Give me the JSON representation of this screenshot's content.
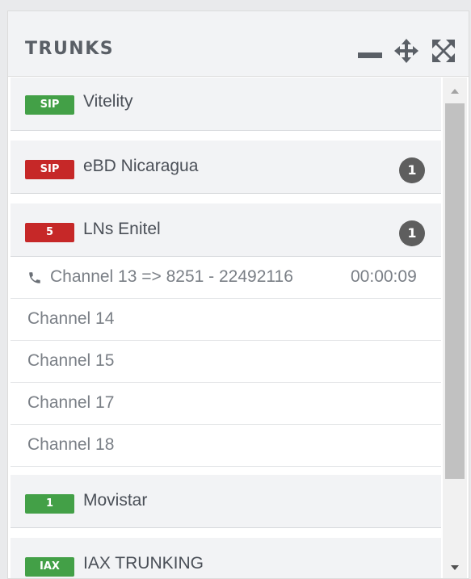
{
  "panel": {
    "title": "TRUNKS",
    "header_icons": [
      "minimize-icon",
      "move-icon",
      "expand-icon"
    ]
  },
  "trunks": [
    {
      "badge": "SIP",
      "badge_color": "#43a047",
      "name": "Vitelity",
      "count": ""
    },
    {
      "badge": "SIP",
      "badge_color": "#c62828",
      "name": "eBD Nicaragua",
      "count": "1"
    },
    {
      "badge": "5",
      "badge_color": "#c62828",
      "name": "LNs Enitel",
      "count": "1",
      "channels": [
        {
          "label": "Channel 13 => 8251 - 22492116",
          "time": "00:00:09",
          "icon": "phone-icon"
        },
        {
          "label": "Channel 14"
        },
        {
          "label": "Channel 15"
        },
        {
          "label": "Channel 17"
        },
        {
          "label": "Channel 18"
        }
      ]
    },
    {
      "badge": "1",
      "badge_color": "#43a047",
      "name": "Movistar",
      "count": ""
    },
    {
      "badge": "IAX",
      "badge_color": "#43a047",
      "name": "IAX TRUNKING",
      "count": ""
    }
  ],
  "colors": {
    "green": "#43a047",
    "red": "#c62828",
    "count_bg": "#5e5e5e",
    "header_bg": "#f2f3f5"
  }
}
